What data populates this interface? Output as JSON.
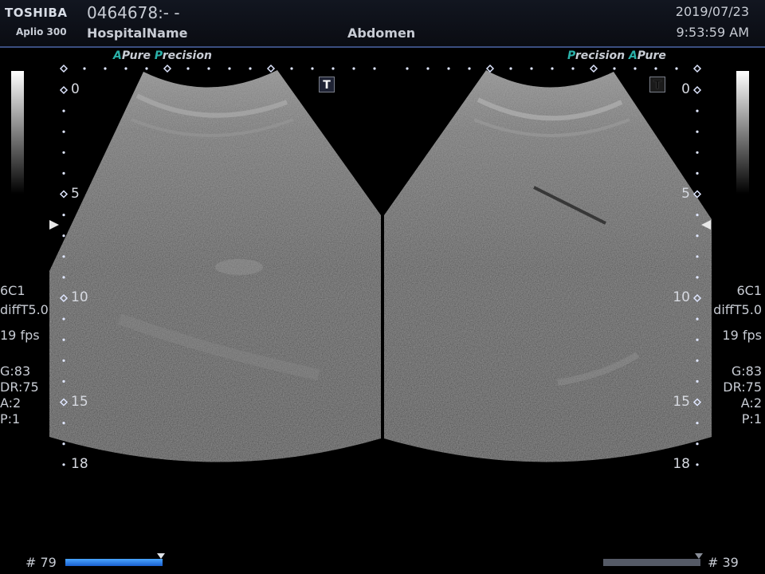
{
  "header": {
    "brand": "TOSHIBA",
    "model": "Aplio 300",
    "patient_id": "0464678:- -",
    "hospital": "HospitalName",
    "preset": "Abdomen",
    "date": "2019/07/23",
    "time": "9:53:59 AM"
  },
  "brandmark_left": {
    "a": "A",
    "pure": "Pure ",
    "p": "P",
    "recision": "recision"
  },
  "brandmark_right": {
    "p": "P",
    "recision": "recision  ",
    "a": "A",
    "pure": "Pure"
  },
  "t_marker": "T",
  "depth_scale": {
    "labels": [
      "0",
      "5",
      "10",
      "15",
      "18"
    ],
    "values": [
      0,
      5,
      10,
      15,
      18
    ],
    "max": 18
  },
  "left_panel": {
    "probe": "6C1",
    "mode": "diffT5.0",
    "fps": "19 fps",
    "gain": "G:83",
    "dr": "DR:75",
    "a": "A:2",
    "p": "P:1",
    "frame": "# 79",
    "cine_position": 1.0
  },
  "right_panel": {
    "probe": "6C1",
    "mode": "diffT5.0",
    "fps": "19 fps",
    "gain": "G:83",
    "dr": "DR:75",
    "a": "A:2",
    "p": "P:1",
    "frame": "# 39",
    "cine_position": 1.0
  },
  "colors": {
    "accent": "#2ab0a8",
    "header_border": "#3a4e80",
    "active_cine": "#2f7fe8"
  }
}
